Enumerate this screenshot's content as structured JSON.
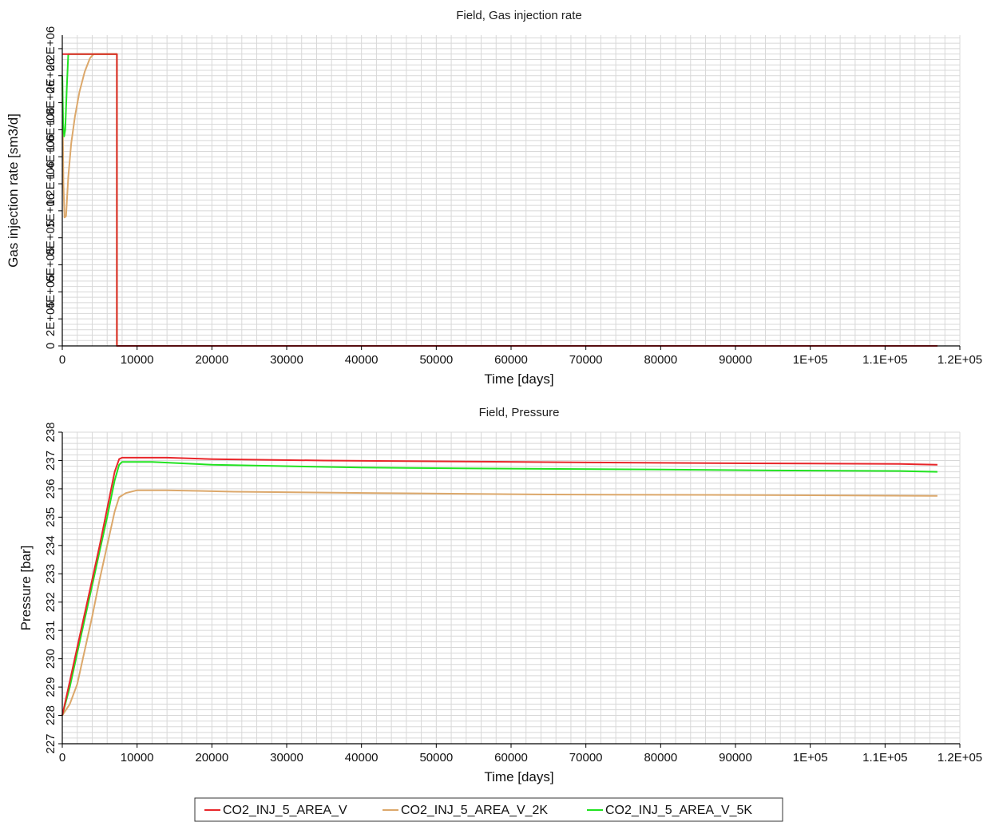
{
  "colors": {
    "CO2_INJ_5_AREA_V": "#e8262a",
    "CO2_INJ_5_AREA_V_2K": "#dca86b",
    "CO2_INJ_5_AREA_V_5K": "#21e321",
    "grid": "#d8d8d8",
    "axis": "#000000"
  },
  "legend": {
    "items": [
      "CO2_INJ_5_AREA_V",
      "CO2_INJ_5_AREA_V_2K",
      "CO2_INJ_5_AREA_V_5K"
    ],
    "placement": "bottom"
  },
  "chart_data": [
    {
      "type": "line",
      "title": "Field, Gas injection rate",
      "xlabel": "Time [days]",
      "ylabel": "Gas injection rate [sm3/d]",
      "xlim": [
        0,
        120000
      ],
      "ylim": [
        0,
        2300000
      ],
      "grid": true,
      "xticks": [
        {
          "v": 0,
          "label": "0"
        },
        {
          "v": 10000,
          "label": "10000"
        },
        {
          "v": 20000,
          "label": "20000"
        },
        {
          "v": 30000,
          "label": "30000"
        },
        {
          "v": 40000,
          "label": "40000"
        },
        {
          "v": 50000,
          "label": "50000"
        },
        {
          "v": 60000,
          "label": "60000"
        },
        {
          "v": 70000,
          "label": "70000"
        },
        {
          "v": 80000,
          "label": "80000"
        },
        {
          "v": 90000,
          "label": "90000"
        },
        {
          "v": 100000,
          "label": "1E+05"
        },
        {
          "v": 110000,
          "label": "1.1E+05"
        },
        {
          "v": 120000,
          "label": "1.2E+05"
        }
      ],
      "yticks": [
        {
          "v": 0,
          "label": "0"
        },
        {
          "v": 200000,
          "label": "2E+05"
        },
        {
          "v": 400000,
          "label": "4E+05"
        },
        {
          "v": 600000,
          "label": "6E+05"
        },
        {
          "v": 800000,
          "label": "8E+05"
        },
        {
          "v": 1000000,
          "label": "1E+06"
        },
        {
          "v": 1200000,
          "label": "1.2E+06"
        },
        {
          "v": 1400000,
          "label": "1.4E+06"
        },
        {
          "v": 1600000,
          "label": "1.6E+06"
        },
        {
          "v": 1800000,
          "label": "1.8E+06"
        },
        {
          "v": 2000000,
          "label": "2E+06"
        },
        {
          "v": 2200000,
          "label": "2.2E+06"
        }
      ],
      "series": [
        {
          "name": "CO2_INJ_5_AREA_V_2K",
          "color": "#dca86b",
          "x": [
            0,
            150,
            300,
            500,
            800,
            1200,
            1700,
            2300,
            3000,
            3700,
            4200,
            7300,
            7300,
            117000
          ],
          "y": [
            2000000,
            1200000,
            950000,
            960000,
            1250000,
            1500000,
            1700000,
            1880000,
            2030000,
            2130000,
            2160000,
            2160000,
            0,
            0
          ]
        },
        {
          "name": "CO2_INJ_5_AREA_V_5K",
          "color": "#21e321",
          "x": [
            0,
            120,
            250,
            400,
            600,
            800,
            7300,
            7300,
            117000
          ],
          "y": [
            2000000,
            1650000,
            1550000,
            1600000,
            1900000,
            2160000,
            2160000,
            0,
            0
          ]
        },
        {
          "name": "CO2_INJ_5_AREA_V",
          "color": "#e8262a",
          "x": [
            0,
            7300,
            7300,
            117000
          ],
          "y": [
            2160000,
            2160000,
            0,
            0
          ]
        }
      ]
    },
    {
      "type": "line",
      "title": "Field, Pressure",
      "xlabel": "Time [days]",
      "ylabel": "Pressure [bar]",
      "xlim": [
        0,
        120000
      ],
      "ylim": [
        227,
        238
      ],
      "grid": true,
      "xticks": [
        {
          "v": 0,
          "label": "0"
        },
        {
          "v": 10000,
          "label": "10000"
        },
        {
          "v": 20000,
          "label": "20000"
        },
        {
          "v": 30000,
          "label": "30000"
        },
        {
          "v": 40000,
          "label": "40000"
        },
        {
          "v": 50000,
          "label": "50000"
        },
        {
          "v": 60000,
          "label": "60000"
        },
        {
          "v": 70000,
          "label": "70000"
        },
        {
          "v": 80000,
          "label": "80000"
        },
        {
          "v": 90000,
          "label": "90000"
        },
        {
          "v": 100000,
          "label": "1E+05"
        },
        {
          "v": 110000,
          "label": "1.1E+05"
        },
        {
          "v": 120000,
          "label": "1.2E+05"
        }
      ],
      "yticks": [
        {
          "v": 227,
          "label": "227"
        },
        {
          "v": 228,
          "label": "228"
        },
        {
          "v": 229,
          "label": "229"
        },
        {
          "v": 230,
          "label": "230"
        },
        {
          "v": 231,
          "label": "231"
        },
        {
          "v": 232,
          "label": "232"
        },
        {
          "v": 233,
          "label": "233"
        },
        {
          "v": 234,
          "label": "234"
        },
        {
          "v": 235,
          "label": "235"
        },
        {
          "v": 236,
          "label": "236"
        },
        {
          "v": 237,
          "label": "237"
        },
        {
          "v": 238,
          "label": "238"
        }
      ],
      "series": [
        {
          "name": "CO2_INJ_5_AREA_V_2K",
          "color": "#dca86b",
          "x": [
            0,
            1000,
            2000,
            3000,
            4000,
            5000,
            6000,
            7000,
            7600,
            8500,
            10000,
            14000,
            23000,
            42000,
            55000,
            65000,
            94000,
            117000
          ],
          "y": [
            228,
            228.4,
            229.1,
            230.3,
            231.5,
            232.8,
            234.0,
            235.2,
            235.7,
            235.85,
            235.95,
            235.95,
            235.9,
            235.85,
            235.82,
            235.8,
            235.78,
            235.75
          ]
        },
        {
          "name": "CO2_INJ_5_AREA_V_5K",
          "color": "#21e321",
          "x": [
            0,
            1000,
            2000,
            3000,
            4000,
            5000,
            6000,
            7000,
            7600,
            8000,
            12000,
            20000,
            40000,
            55000,
            80000,
            95000,
            112000,
            117000
          ],
          "y": [
            228,
            229.0,
            230.2,
            231.4,
            232.6,
            233.8,
            235.0,
            236.3,
            236.85,
            236.95,
            236.95,
            236.85,
            236.75,
            236.72,
            236.68,
            236.65,
            236.63,
            236.6
          ]
        },
        {
          "name": "CO2_INJ_5_AREA_V",
          "color": "#e8262a",
          "x": [
            0,
            1000,
            2000,
            3000,
            4000,
            5000,
            6000,
            7000,
            7600,
            8000,
            14000,
            20000,
            35000,
            46000,
            70000,
            92000,
            112000,
            117000
          ],
          "y": [
            228,
            229.2,
            230.4,
            231.6,
            232.8,
            234.0,
            235.3,
            236.6,
            237.05,
            237.1,
            237.1,
            237.05,
            237.0,
            236.98,
            236.93,
            236.9,
            236.88,
            236.85
          ]
        }
      ]
    }
  ]
}
